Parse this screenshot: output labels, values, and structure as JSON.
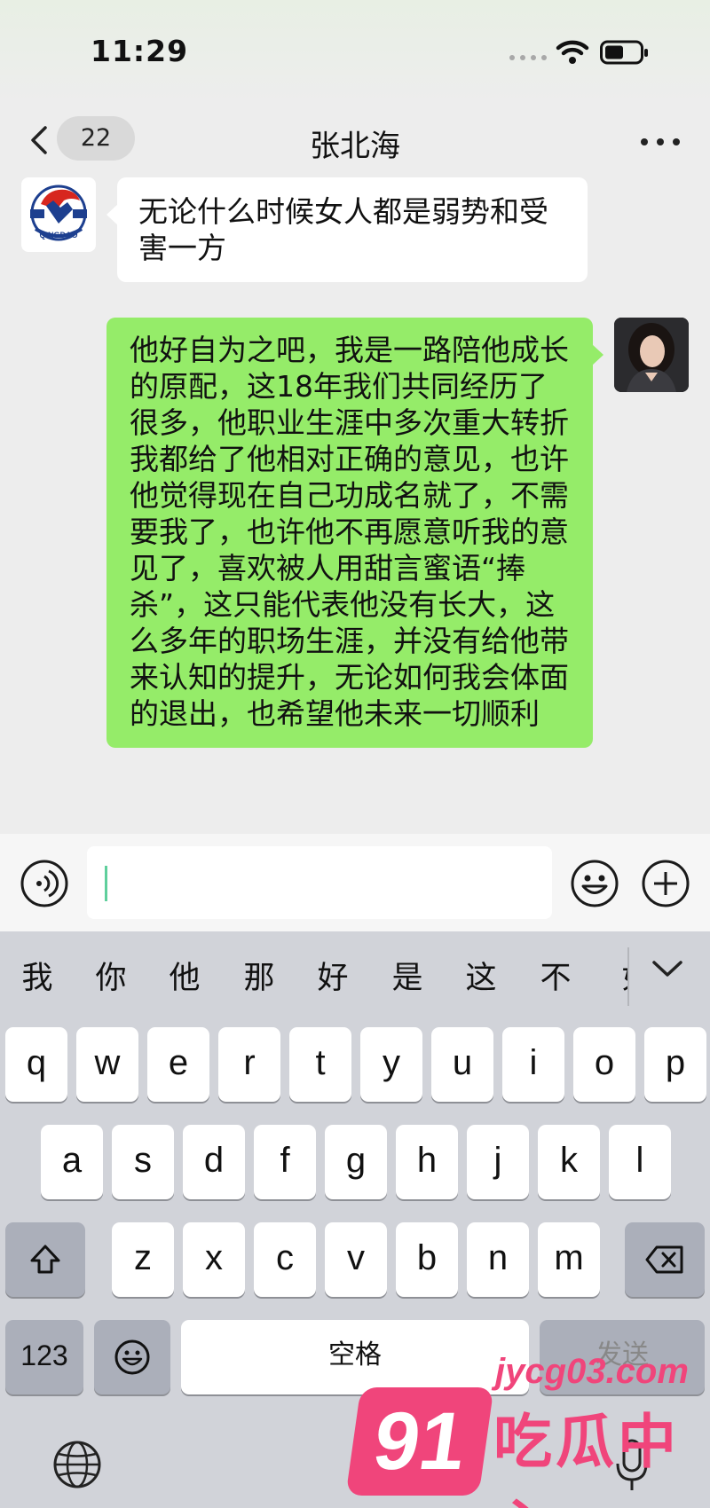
{
  "status_bar": {
    "time": "11:29",
    "icons": [
      "signal-dots-icon",
      "wifi-icon",
      "battery-icon"
    ]
  },
  "nav": {
    "back_icon": "chevron-left-icon",
    "unread_count": "22",
    "title": "张北海",
    "more_icon": "more-dots-icon"
  },
  "messages": [
    {
      "side": "left",
      "avatar": "eagle-logo-avatar",
      "avatar_text": "QINGDAO",
      "text": "无论什么时候女人都是弱势和受害一方"
    },
    {
      "side": "right",
      "avatar": "woman-photo-avatar",
      "text": "他好自为之吧，我是一路陪他成长的原配，这18年我们共同经历了很多，他职业生涯中多次重大转折我都给了他相对正确的意见，也许他觉得现在自己功成名就了，不需要我了，也许他不再愿意听我的意见了，喜欢被人用甜言蜜语“捧杀”，这只能代表他没有长大，这么多年的职场生涯，并没有给他带来认知的提升，无论如何我会体面的退出，也希望他未来一切顺利"
    }
  ],
  "input_bar": {
    "voice_icon": "voice-mode-icon",
    "input_value": "",
    "emoji_icon": "emoji-icon",
    "plus_icon": "plus-icon"
  },
  "keyboard": {
    "candidates": [
      "我",
      "你",
      "他",
      "那",
      "好",
      "是",
      "这",
      "不",
      "如"
    ],
    "row1": [
      "q",
      "w",
      "e",
      "r",
      "t",
      "y",
      "u",
      "i",
      "o",
      "p"
    ],
    "row2": [
      "a",
      "s",
      "d",
      "f",
      "g",
      "h",
      "j",
      "k",
      "l"
    ],
    "row3": [
      "z",
      "x",
      "c",
      "v",
      "b",
      "n",
      "m"
    ],
    "shift_icon": "shift-icon",
    "delete_icon": "delete-icon",
    "numbers_label": "123",
    "emoji_key_icon": "emoji-icon",
    "space_label": "空格",
    "send_label": "发送",
    "globe_icon": "globe-icon",
    "mic_icon": "microphone-icon"
  },
  "watermark": {
    "number": "91",
    "domain": "jycg03.com",
    "name": "吃瓜中心"
  }
}
